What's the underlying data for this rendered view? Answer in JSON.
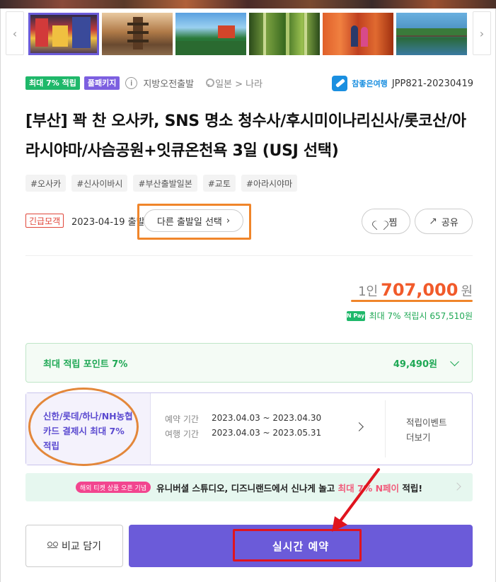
{
  "gallery": {
    "prev_icon": "‹",
    "next_icon": "›",
    "thumbnails": [
      "osaka-dotonbori",
      "kyoto-yasaka-pagoda",
      "kiyomizu-dera",
      "arashiyama-bamboo",
      "fushimi-inari",
      "arashiyama-bridge"
    ]
  },
  "badges": {
    "points": "최대 7% 적립",
    "package": "풀패키지",
    "info_icon": "i",
    "departure": "지방오전출발",
    "location": "일본 > 나라"
  },
  "agency": {
    "name": "참좋은여행",
    "code": "JPP821-20230419"
  },
  "title": "[부산] 꽉 찬 오사카, SNS 명소 청수사/후시미이나리신사/롯코산/아라시야마/사슴공원+잇큐온천욕 3일 (USJ 선택)",
  "tags": [
    "#오사카",
    "#신사이바시",
    "#부산출발일본",
    "#교토",
    "#아라시야마"
  ],
  "departure": {
    "urgent": "긴급모객",
    "date": "2023-04-19 출발",
    "other_date_button": "다른 출발일 선택",
    "chevron": "›"
  },
  "actions": {
    "zzim": "찜",
    "share": "공유",
    "share_icon": "↗"
  },
  "price": {
    "per_person": "1인",
    "amount": "707,000",
    "currency": "원",
    "npay_icon": "N Pay",
    "npay_text": "최대 7% 적립시 657,510원"
  },
  "points": {
    "label": "최대 적립 포인트 7%",
    "value": "49,490원"
  },
  "card": {
    "description": "신한/롯데/하나/NH농협 카드 결제시 최대 7% 적립",
    "reserve_label": "예약 기간",
    "reserve_period": "2023.04.03 ~ 2023.04.30",
    "travel_label": "여행 기간",
    "travel_period": "2023.04.03 ~ 2023.05.31",
    "event_line1": "적립이벤트",
    "event_line2": "더보기"
  },
  "banner": {
    "badge": "해외 티켓 상품 오픈 기념",
    "text": "유니버셜 스튜디오, 디즈니랜드에서 신나게 놀고",
    "highlight": "최대 7% N페이",
    "suffix": "적립!"
  },
  "buttons": {
    "compare": "비교 담기",
    "reserve": "실시간 예약"
  },
  "colors": {
    "accent": "#6b5bd9",
    "price": "#f15a2a",
    "green": "#1fb86a",
    "annotation_orange": "#f0852a",
    "annotation_red": "#e0141e"
  }
}
